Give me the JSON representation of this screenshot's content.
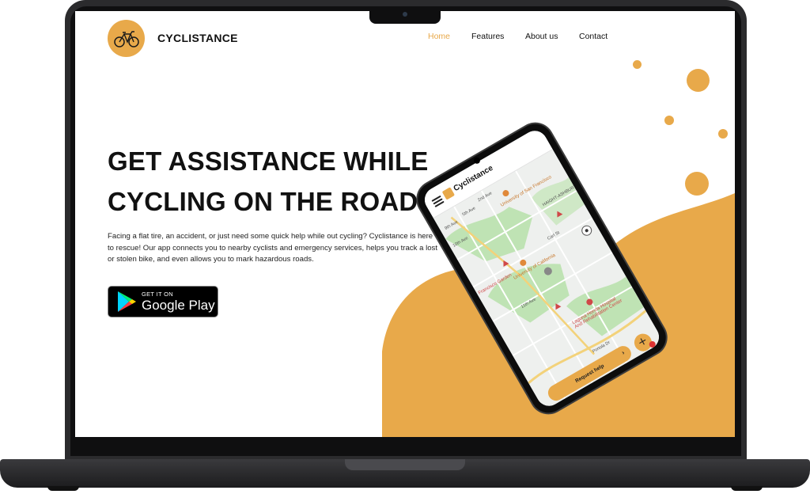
{
  "header": {
    "brand": "CYCLISTANCE",
    "nav": [
      {
        "label": "Home",
        "active": true
      },
      {
        "label": "Features",
        "active": false
      },
      {
        "label": "About us",
        "active": false
      },
      {
        "label": "Contact",
        "active": false
      }
    ]
  },
  "hero": {
    "title_line1": "GET ASSISTANCE WHILE",
    "title_line2": "CYCLING ON THE ROAD",
    "description": "Facing a flat tire, an accident, or just need some quick help while out cycling? Cyclistance is here to rescue! Our app connects you to nearby cyclists and emergency services, helps you track a lost or stolen bike, and even allows you to mark hazardous roads.",
    "store_button": {
      "small": "GET IT ON",
      "big": "Google Play"
    }
  },
  "phone": {
    "app_title": "Cyclistance",
    "request_button": "Request help",
    "add_button": "+",
    "map_labels": {
      "ucsf": "University of San Francisco",
      "haight": "HAIGHT-ASHBURY",
      "carl": "Carl St",
      "ucal": "University of California",
      "eleventh": "11th Ave",
      "tenth": "10th Ave",
      "fifth": "5th Ave",
      "second": "2nd Ave",
      "ninth": "9th Ave",
      "garden": "Francisco Garden",
      "laguna": "Laguna Honda Hospital And Rehabilitation Center",
      "portola": "Portola Dr"
    }
  },
  "colors": {
    "accent": "#e8a94a",
    "text": "#111111",
    "frame": "#2b2b2d"
  }
}
